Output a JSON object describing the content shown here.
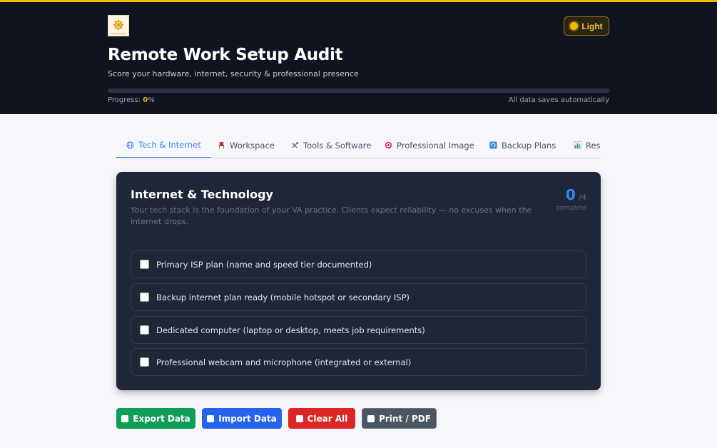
{
  "header": {
    "logo_text": "Goldsmith Audit",
    "theme_label": "Light",
    "title": "Remote Work Setup Audit",
    "subtitle": "Score your hardware, internet, security & professional presence",
    "progress_prefix": "Progress: ",
    "progress_value": "0",
    "progress_suffix": "%",
    "progress_fraction": 0,
    "autosave": "All data saves automatically",
    "accent_color": "#f5b800"
  },
  "tabs": [
    {
      "label": "Tech & Internet",
      "icon": "globe-icon",
      "active": true
    },
    {
      "label": "Workspace",
      "icon": "chair-icon",
      "active": false
    },
    {
      "label": "Tools & Software",
      "icon": "tools-icon",
      "active": false
    },
    {
      "label": "Professional Image",
      "icon": "target-icon",
      "active": false
    },
    {
      "label": "Backup Plans",
      "icon": "refresh-icon",
      "active": false
    },
    {
      "label": "Results",
      "icon": "bar-chart-icon",
      "active": false
    }
  ],
  "section": {
    "title": "Internet & Technology",
    "description": "Your tech stack is the foundation of your VA practice. Clients expect reliability — no excuses when the internet drops.",
    "count": "0",
    "total": "/4",
    "count_label": "complete",
    "items": [
      {
        "label": "Primary ISP plan (name and speed tier documented)",
        "checked": false
      },
      {
        "label": "Backup internet plan ready (mobile hotspot or secondary ISP)",
        "checked": false
      },
      {
        "label": "Dedicated computer (laptop or desktop, meets job requirements)",
        "checked": false
      },
      {
        "label": "Professional webcam and microphone (integrated or external)",
        "checked": false
      }
    ]
  },
  "actions": {
    "export": {
      "label": "Export Data",
      "color": "#0f9d58"
    },
    "import": {
      "label": "Import Data",
      "color": "#2563eb"
    },
    "clear": {
      "label": "Clear All",
      "color": "#dc2626"
    },
    "print": {
      "label": "Print / PDF",
      "color": "#4b5563"
    }
  }
}
